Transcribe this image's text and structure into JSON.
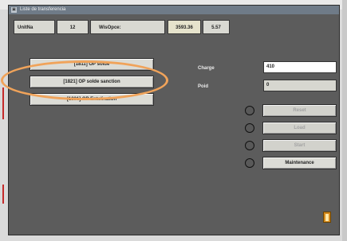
{
  "window": {
    "title": "Liste de transferencia"
  },
  "header": {
    "unit_label": "UnitNa",
    "unit_value": "12",
    "wiso_label": "WisOpce:",
    "value1": "3593.36",
    "value2": "5.57"
  },
  "operations": [
    {
      "label": "[1811] OP solde"
    },
    {
      "label": "[1821] OP solde sanction"
    },
    {
      "label": "[1831] OP Enteliration"
    }
  ],
  "charge": {
    "label": "Charge",
    "value": "410"
  },
  "poid": {
    "label": "Poid",
    "value": "0"
  },
  "actions": {
    "reset": "Reset",
    "load": "Load",
    "start": "Start",
    "maintenance": "Maintenance"
  },
  "colors": {
    "window_bg": "#5c5c5c",
    "highlight_oval": "#f0a35a"
  },
  "icons": {
    "exit": "door-exit-icon"
  }
}
